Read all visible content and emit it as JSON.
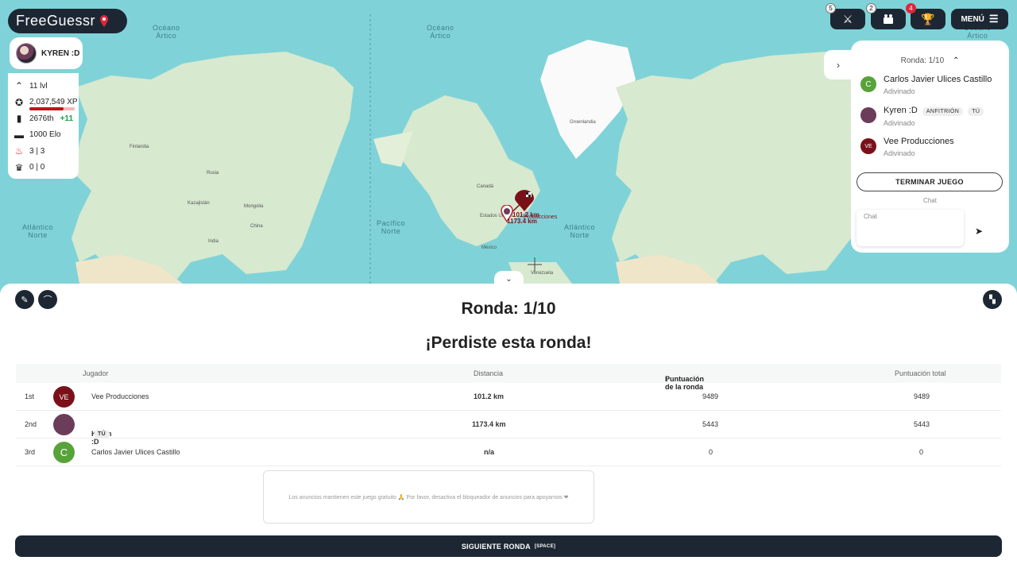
{
  "app": {
    "logo_text": "FreeGuessr"
  },
  "topbar": {
    "battle_badge": "5",
    "party_badge": "2",
    "trophy_badge": "4",
    "menu_label": "MENÚ"
  },
  "profile": {
    "name": "KYREN :D",
    "level": "11 lvl",
    "xp": "2,037,549 XP",
    "rank": "2676th",
    "rank_change": "+11",
    "elo": "1000 Elo",
    "streak": "3 | 3",
    "wins": "0 | 0"
  },
  "map": {
    "labels": {
      "arctic_ocean_left": "Océano\nÁrtico",
      "arctic_ocean_mid": "Océano\nÁrtico",
      "arctic_ocean_right": "Océano\nÁrtico",
      "atlantic_left": "Atlántico\nNorte",
      "pacific": "Pacífico\nNorte",
      "atlantic_mid": "Atlántico\nNorte",
      "greenland": "Groenlandia",
      "canada": "Canadá",
      "usa": "Estados Unidos",
      "mexico": "México",
      "venezuela": "Venezuela",
      "mongolia": "Mongolia",
      "kazakhstan": "Kazajistán",
      "china": "China",
      "india": "India",
      "finland": "Finlandia",
      "russia": "Rusia"
    },
    "guess_label_1": "1173.4 km",
    "guess_label_2": "101.2 km",
    "guess_name": "Producciones"
  },
  "room": {
    "round_label": "Ronda: 1/10",
    "players": [
      {
        "initial": "C",
        "name": "Carlos Javier Ulices Castillo",
        "status": "Adivinado",
        "color": "#57a33a"
      },
      {
        "initial": "",
        "name": "Kyren :D",
        "tags": [
          "ANFITRIÓN",
          "TÚ"
        ],
        "status": "Adivinado",
        "color": "#6b3d5a"
      },
      {
        "initial": "VE",
        "name": "Vee Producciones",
        "status": "Adivinado",
        "color": "#7a1119"
      }
    ],
    "end_game_label": "TERMINAR JUEGO",
    "chat_title": "Chat",
    "chat_placeholder": "Chat"
  },
  "result": {
    "title": "Ronda: 1/10",
    "subtitle": "¡Perdiste esta ronda!",
    "columns": {
      "player": "Jugador",
      "distance": "Distancia",
      "round_score": "Puntuación de la ronda",
      "total_score": "Puntuación total"
    },
    "rows": [
      {
        "place": "1st",
        "initial": "VE",
        "name": "Vee Producciones",
        "tag": "",
        "distance": "101.2 km",
        "round_score": "9489",
        "total_score": "9489",
        "color": "#7a1119"
      },
      {
        "place": "2nd",
        "initial": "",
        "name": "Kyren :D",
        "tag": "TÚ",
        "distance": "1173.4 km",
        "round_score": "5443",
        "total_score": "5443",
        "color": "#6b3d5a"
      },
      {
        "place": "3rd",
        "initial": "C",
        "name": "Carlos Javier Ulices Castillo",
        "tag": "",
        "distance": "n/a",
        "round_score": "0",
        "total_score": "0",
        "color": "#57a33a"
      }
    ],
    "ad_text": "Los anuncios mantienen este juego gratuito 🙏 Por favor, desactiva el bloqueador de anuncios para apoyarnos ❤",
    "next_label": "SIGUIENTE RONDA",
    "next_shortcut": "[SPACE]"
  }
}
